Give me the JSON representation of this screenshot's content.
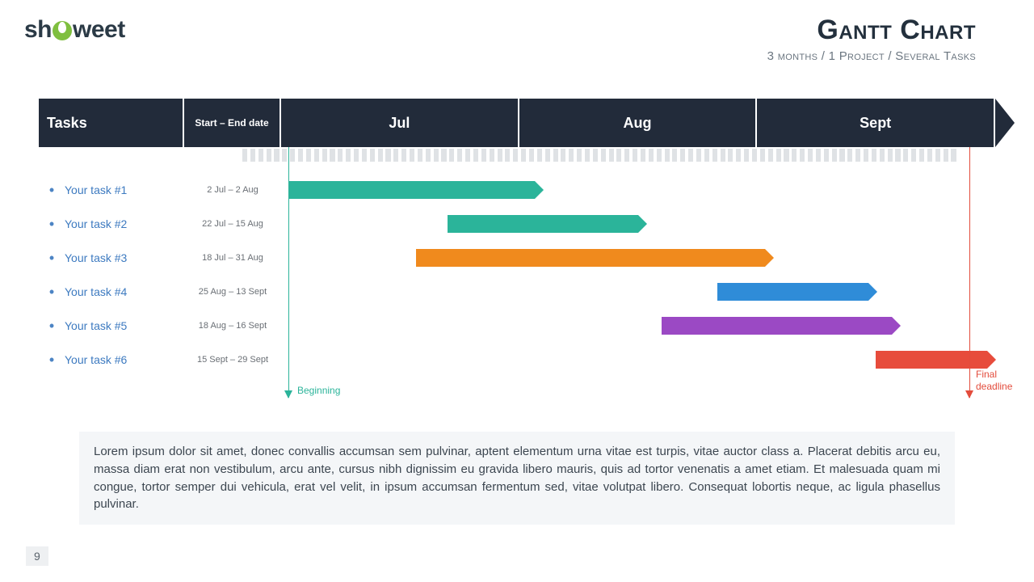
{
  "logo": {
    "prefix": "sh",
    "suffix": "weet"
  },
  "title": "Gantt Chart",
  "subtitle": "3 months / 1 Project / Several Tasks",
  "header": {
    "tasks_col": "Tasks",
    "dates_col": "Start – End date",
    "months": [
      "Jul",
      "Aug",
      "Sept"
    ]
  },
  "timeline": {
    "start_day_index": 0,
    "total_days": 90,
    "begin_label": "Beginning",
    "end_label": "Final\ndeadline"
  },
  "tasks": [
    {
      "name": "Your task #1",
      "dates": "2 Jul – 2 Aug",
      "start_pct": 1.1,
      "len_pct": 34.4,
      "color": "#2bb49a"
    },
    {
      "name": "Your task #2",
      "dates": "22 Jul – 15 Aug",
      "start_pct": 23.3,
      "len_pct": 26.7,
      "color": "#2bb49a"
    },
    {
      "name": "Your task #3",
      "dates": "18 Jul – 31 Aug",
      "start_pct": 18.9,
      "len_pct": 48.9,
      "color": "#f08a1d"
    },
    {
      "name": "Your task #4",
      "dates": "25 Aug – 13 Sept",
      "start_pct": 61.1,
      "len_pct": 21.1,
      "color": "#2f8cd8"
    },
    {
      "name": "Your task #5",
      "dates": "18 Aug – 16 Sept",
      "start_pct": 53.3,
      "len_pct": 32.2,
      "color": "#9b49c4"
    },
    {
      "name": "Your task #6",
      "dates": "15 Sept – 29 Sept",
      "start_pct": 83.3,
      "len_pct": 15.6,
      "color": "#e74c3c"
    }
  ],
  "body_text": "Lorem ipsum dolor sit amet, donec convallis accumsan sem pulvinar, aptent elementum urna vitae est turpis, vitae auctor class a. Placerat debitis arcu eu, massa diam erat non vestibulum, arcu ante, cursus nibh dignissim eu gravida libero mauris, quis ad tortor venenatis a amet etiam. Et malesuada quam mi congue, tortor semper dui vehicula, erat vel velit, in ipsum accumsan fermentum sed, vitae volutpat libero. Consequat lobortis neque, ac ligula phasellus pulvinar.",
  "page_number": "9",
  "chart_data": {
    "type": "bar",
    "orientation": "horizontal-gantt",
    "title": "Gantt Chart",
    "subtitle": "3 months / 1 Project / Several Tasks",
    "x_axis": {
      "label": "",
      "months": [
        "Jul",
        "Aug",
        "Sept"
      ],
      "range_days": [
        1,
        90
      ]
    },
    "y_axis": {
      "label": "Tasks"
    },
    "series": [
      {
        "name": "Your task #1",
        "start": "2 Jul",
        "end": "2 Aug",
        "start_day": 2,
        "end_day": 33,
        "color": "#2bb49a"
      },
      {
        "name": "Your task #2",
        "start": "22 Jul",
        "end": "15 Aug",
        "start_day": 22,
        "end_day": 46,
        "color": "#2bb49a"
      },
      {
        "name": "Your task #3",
        "start": "18 Jul",
        "end": "31 Aug",
        "start_day": 18,
        "end_day": 62,
        "color": "#f08a1d"
      },
      {
        "name": "Your task #4",
        "start": "25 Aug",
        "end": "13 Sept",
        "start_day": 56,
        "end_day": 75,
        "color": "#2f8cd8"
      },
      {
        "name": "Your task #5",
        "start": "18 Aug",
        "end": "16 Sept",
        "start_day": 49,
        "end_day": 78,
        "color": "#9b49c4"
      },
      {
        "name": "Your task #6",
        "start": "15 Sept",
        "end": "29 Sept",
        "start_day": 77,
        "end_day": 91,
        "color": "#e74c3c"
      }
    ],
    "annotations": [
      {
        "label": "Beginning",
        "day": 2,
        "color": "#2bb49a"
      },
      {
        "label": "Final deadline",
        "day": 90,
        "color": "#e34c3c"
      }
    ]
  }
}
